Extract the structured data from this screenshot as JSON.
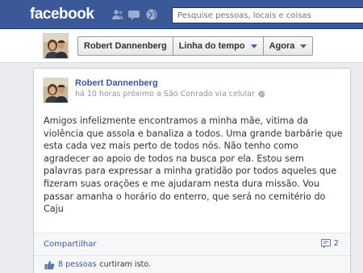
{
  "topbar": {
    "logo": "facebook",
    "search_placeholder": "Pesquise pessoas, locais e coisas",
    "icons": [
      "friends-icon",
      "messages-icon",
      "globe-icon"
    ]
  },
  "nav": {
    "profile_name": "Robert Dannenberg",
    "timeline_label": "Linha do tempo",
    "when_label": "Agora"
  },
  "post": {
    "author": "Robert Dannenberg",
    "meta": "há 10 horas próximo a São Conrado via celular",
    "text": "Amigos infelizmente encontramos a minha mãe, vitima da violência que assola e banaliza a todos. Uma grande barbárie que esta cada vez mais perto de todos nós. Não tenho como agradecer ao apoio de todos na busca por ela. Estou sem palavras para expressar a minha gratidão por todos aqueles que fizeram suas orações e me ajudaram nesta dura missão. Vou passar amanha o horário do enterro, que será no cemitério do Caju",
    "share_label": "Compartilhar",
    "comment_count": "2",
    "likes_count_text": "8 pessoas",
    "likes_suffix": "curtiram isto."
  },
  "colors": {
    "brand": "#3b5998",
    "link": "#3b5998",
    "meta_text": "#8d94a0"
  }
}
